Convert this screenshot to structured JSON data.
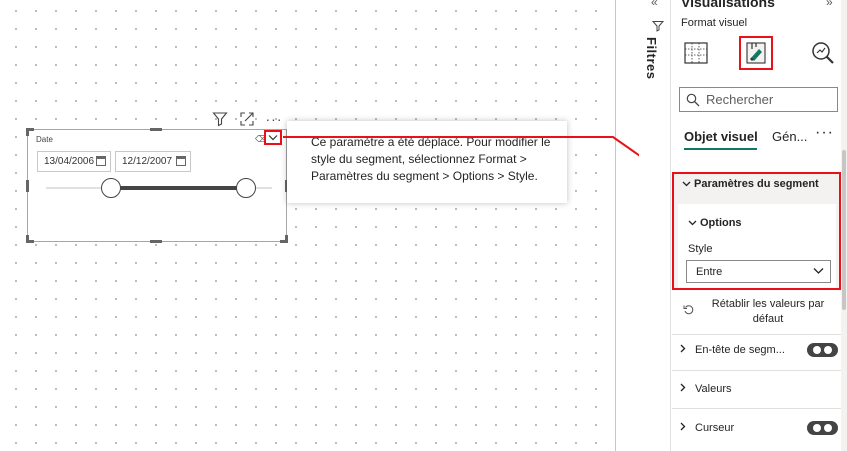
{
  "canvas": {
    "slicer": {
      "title": "Date",
      "start_date": "13/04/2006",
      "end_date": "12/12/2007"
    },
    "tooltip": {
      "text": "Ce paramètre a été déplacé. Pour modifier le style du segment, sélectionnez Format > Paramètres du segment > Options > Style."
    },
    "header_icons": [
      "filter-icon",
      "focus-mode-icon",
      "more-options-icon"
    ]
  },
  "filters_pane": {
    "label": "Filtres"
  },
  "visualizations_pane": {
    "title": "Visualisations",
    "format_label": "Format visuel",
    "search_placeholder": "Rechercher",
    "tabs": [
      {
        "label": "Objet visuel",
        "active": true
      },
      {
        "label": "Gén...",
        "active": false
      }
    ],
    "more_tabs": "···",
    "section": {
      "title": "Paramètres du segment",
      "options": {
        "title": "Options",
        "style_label": "Style",
        "style_value": "Entre"
      }
    },
    "reset_label": "Rétablir les valeurs par défaut",
    "accordion": [
      {
        "label": "En-tête de segm...",
        "toggle": true
      },
      {
        "label": "Valeurs",
        "toggle": false
      },
      {
        "label": "Curseur",
        "toggle": true
      }
    ]
  },
  "colors": {
    "highlight": "#e8111a",
    "accent": "#117865",
    "toggle_on": "#444444"
  }
}
